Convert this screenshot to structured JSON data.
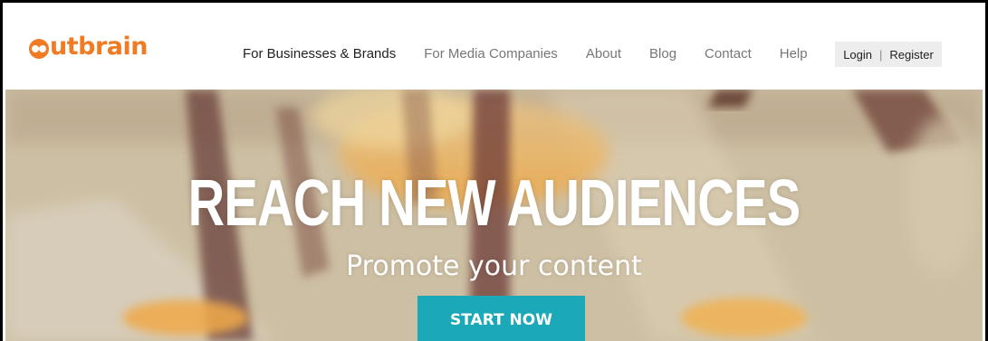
{
  "logo": {
    "text": "utbrain",
    "color": "#f07b22"
  },
  "nav": {
    "items": [
      {
        "label": "For Businesses & Brands"
      },
      {
        "label": "For Media Companies"
      },
      {
        "label": "About"
      },
      {
        "label": "Blog"
      },
      {
        "label": "Contact"
      },
      {
        "label": "Help"
      }
    ]
  },
  "auth": {
    "login": "Login",
    "separator": "|",
    "register": "Register"
  },
  "hero": {
    "title": "REACH NEW AUDIENCES",
    "subtitle": "Promote your content",
    "cta_label": "START NOW",
    "cta_color": "#1ba8b7"
  }
}
